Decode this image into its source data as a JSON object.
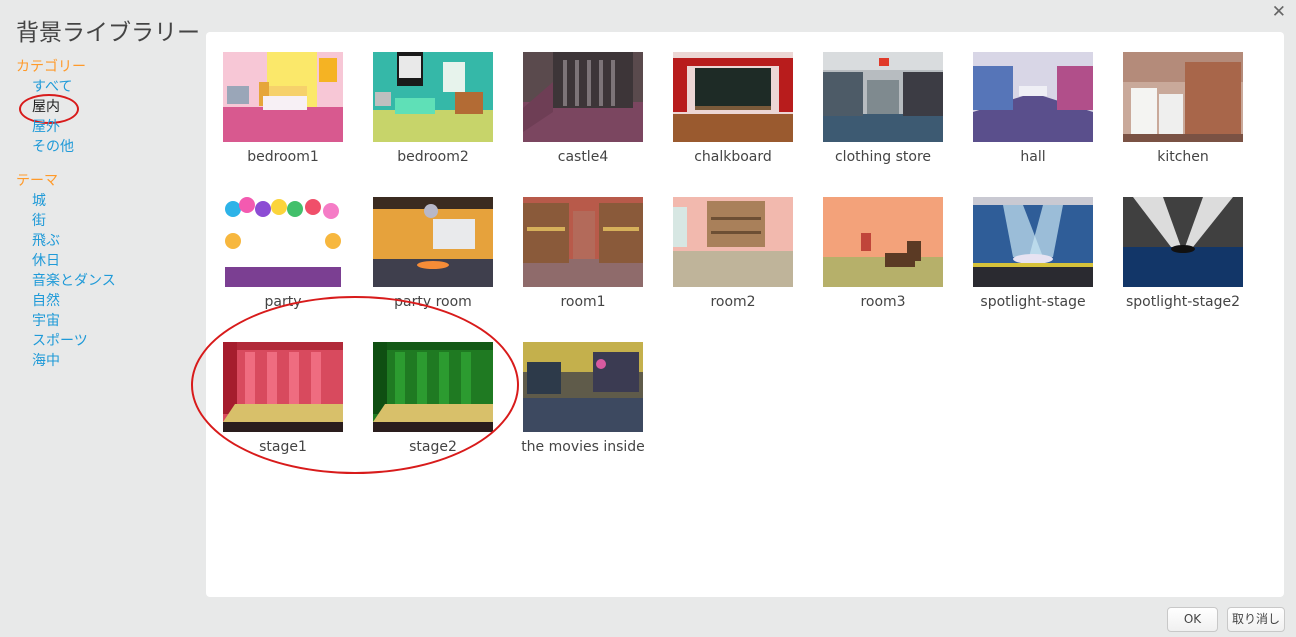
{
  "dialog": {
    "title": "背景ライブラリー",
    "close_glyph": "✕"
  },
  "sidebar": {
    "category_header": "カテゴリー",
    "categories": [
      {
        "label": "すべて"
      },
      {
        "label": "屋内"
      },
      {
        "label": "屋外"
      },
      {
        "label": "その他"
      }
    ],
    "selected_category": "屋内",
    "theme_header": "テーマ",
    "themes": [
      {
        "label": "城"
      },
      {
        "label": "街"
      },
      {
        "label": "飛ぶ"
      },
      {
        "label": "休日"
      },
      {
        "label": "音楽とダンス"
      },
      {
        "label": "自然"
      },
      {
        "label": "宇宙"
      },
      {
        "label": "スポーツ"
      },
      {
        "label": "海中"
      }
    ]
  },
  "backdrops": [
    {
      "name": "bedroom1"
    },
    {
      "name": "bedroom2"
    },
    {
      "name": "castle4"
    },
    {
      "name": "chalkboard"
    },
    {
      "name": "clothing store"
    },
    {
      "name": "hall"
    },
    {
      "name": "kitchen"
    },
    {
      "name": "party"
    },
    {
      "name": "party room"
    },
    {
      "name": "room1"
    },
    {
      "name": "room2"
    },
    {
      "name": "room3"
    },
    {
      "name": "spotlight-stage"
    },
    {
      "name": "spotlight-stage2"
    },
    {
      "name": "stage1"
    },
    {
      "name": "stage2"
    },
    {
      "name": "the movies inside"
    }
  ],
  "footer": {
    "ok_label": "OK",
    "cancel_label": "取り消し"
  },
  "colors": {
    "accent_orange": "#ff9a2a",
    "link_blue": "#1f9ad8",
    "annotation_red": "#d81b1b"
  }
}
